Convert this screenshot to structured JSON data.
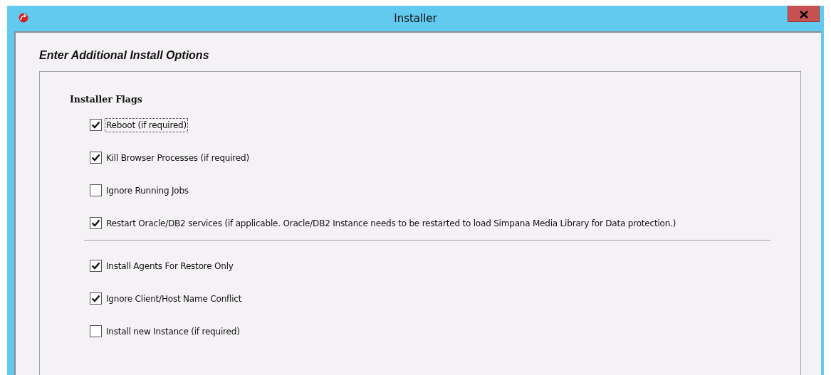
{
  "window": {
    "title": "Installer"
  },
  "heading": "Enter Additional Install Options",
  "group": {
    "title": "Installer Flags",
    "sections": [
      {
        "options": [
          {
            "label": "Reboot (if required)",
            "checked": true,
            "focused": true
          },
          {
            "label": "Kill Browser Processes (if required)",
            "checked": true,
            "focused": false
          },
          {
            "label": "Ignore Running Jobs",
            "checked": false,
            "focused": false
          },
          {
            "label": "Restart Oracle/DB2 services (if applicable. Oracle/DB2 Instance needs to be restarted to load Simpana Media Library for Data protection.)",
            "checked": true,
            "focused": false
          }
        ]
      },
      {
        "options": [
          {
            "label": "Install Agents For Restore Only",
            "checked": true,
            "focused": false
          },
          {
            "label": "Ignore Client/Host Name Conflict",
            "checked": true,
            "focused": false
          },
          {
            "label": "Install new Instance (if required)",
            "checked": false,
            "focused": false
          }
        ]
      }
    ]
  }
}
